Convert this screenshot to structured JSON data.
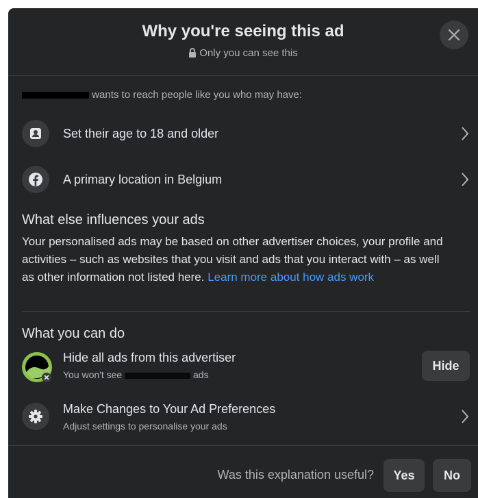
{
  "header": {
    "title": "Why you're seeing this ad",
    "subtitle": "Only you can see this"
  },
  "intro": {
    "text": "wants to reach people like you who may have:"
  },
  "criteria": [
    {
      "label": "Set their age to 18 and older",
      "icon": "profile-card-icon"
    },
    {
      "label": "A primary location in Belgium",
      "icon": "facebook-icon"
    }
  ],
  "influences": {
    "title": "What else influences your ads",
    "body": "Your personalised ads may be based on other advertiser choices, your profile and activities – such as websites that you visit and ads that you interact with – as well as other information not listed here. ",
    "link": "Learn more about how ads work"
  },
  "actions": {
    "title": "What you can do",
    "hide": {
      "title": "Hide all ads from this advertiser",
      "sub_prefix": "You won't see",
      "sub_suffix": "ads",
      "button": "Hide"
    },
    "preferences": {
      "title": "Make Changes to Your Ad Preferences",
      "sub": "Adjust settings to personalise your ads"
    }
  },
  "footer": {
    "question": "Was this explanation useful?",
    "yes": "Yes",
    "no": "No"
  },
  "colors": {
    "panel": "#242526",
    "button": "#3a3b3c",
    "link": "#4599ff"
  }
}
